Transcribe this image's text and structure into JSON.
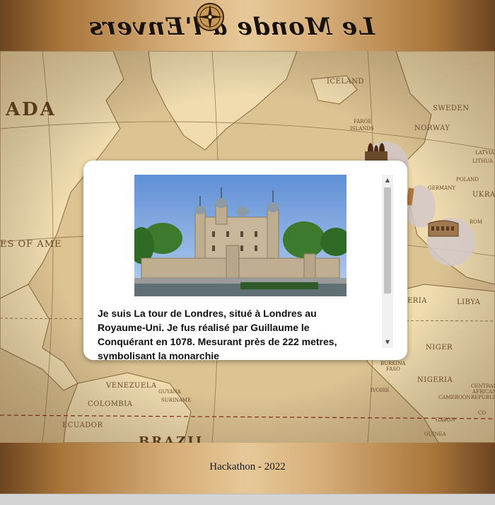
{
  "header": {
    "title": "Le Monde á l'Envers"
  },
  "map": {
    "labels": {
      "ada": "ADA",
      "iceland": "ICELAND",
      "faroe": "FAROE",
      "islands": "ISLANDS",
      "sweden": "SWEDEN",
      "norway": "NORWAY",
      "latvia": "LATVIA",
      "lithuania": "LITHUA",
      "germany": "GERMANY",
      "poland": "POLAND",
      "ukraine": "UKRA",
      "romania": "ROM",
      "states_of_america": "ES OF AME",
      "nigeria_libya": "LIBYA",
      "algeria": "ERIA",
      "niger": "NIGER",
      "nigeria": "NIGERIA",
      "venezuela": "VENEZUELA",
      "colombia": "COLOMBIA",
      "ecuador": "ECUADOR",
      "guyana": "GUYANA",
      "suriname": "SURINAME",
      "brazil": "BRAZIL",
      "burkina": "BURKINA",
      "faso": "FASO",
      "central_african": "CENTRAL",
      "african": "AFRICAN",
      "republic": "REPUBLIC",
      "cameroon": "CAMEROON",
      "gabon": "GABON",
      "co": "CO",
      "guinea": "GUINEA",
      "ivory": "IVOIRE"
    }
  },
  "modal": {
    "description": "Je suis La tour de Londres, situé à Londres au Royaume-Uni. Je fus réalisé par Guillaume le Conquérant en 1078. Mesurant près de 222 metres, symbolisant la monarchie"
  },
  "footer": {
    "text": "Hackathon - 2022"
  },
  "colors": {
    "header_gradient_dark": "#6b4420",
    "header_gradient_light": "#e7c999",
    "map_parchment": "#e9d3a4",
    "sea": "#d9bf8c",
    "land": "#f0dcae"
  }
}
